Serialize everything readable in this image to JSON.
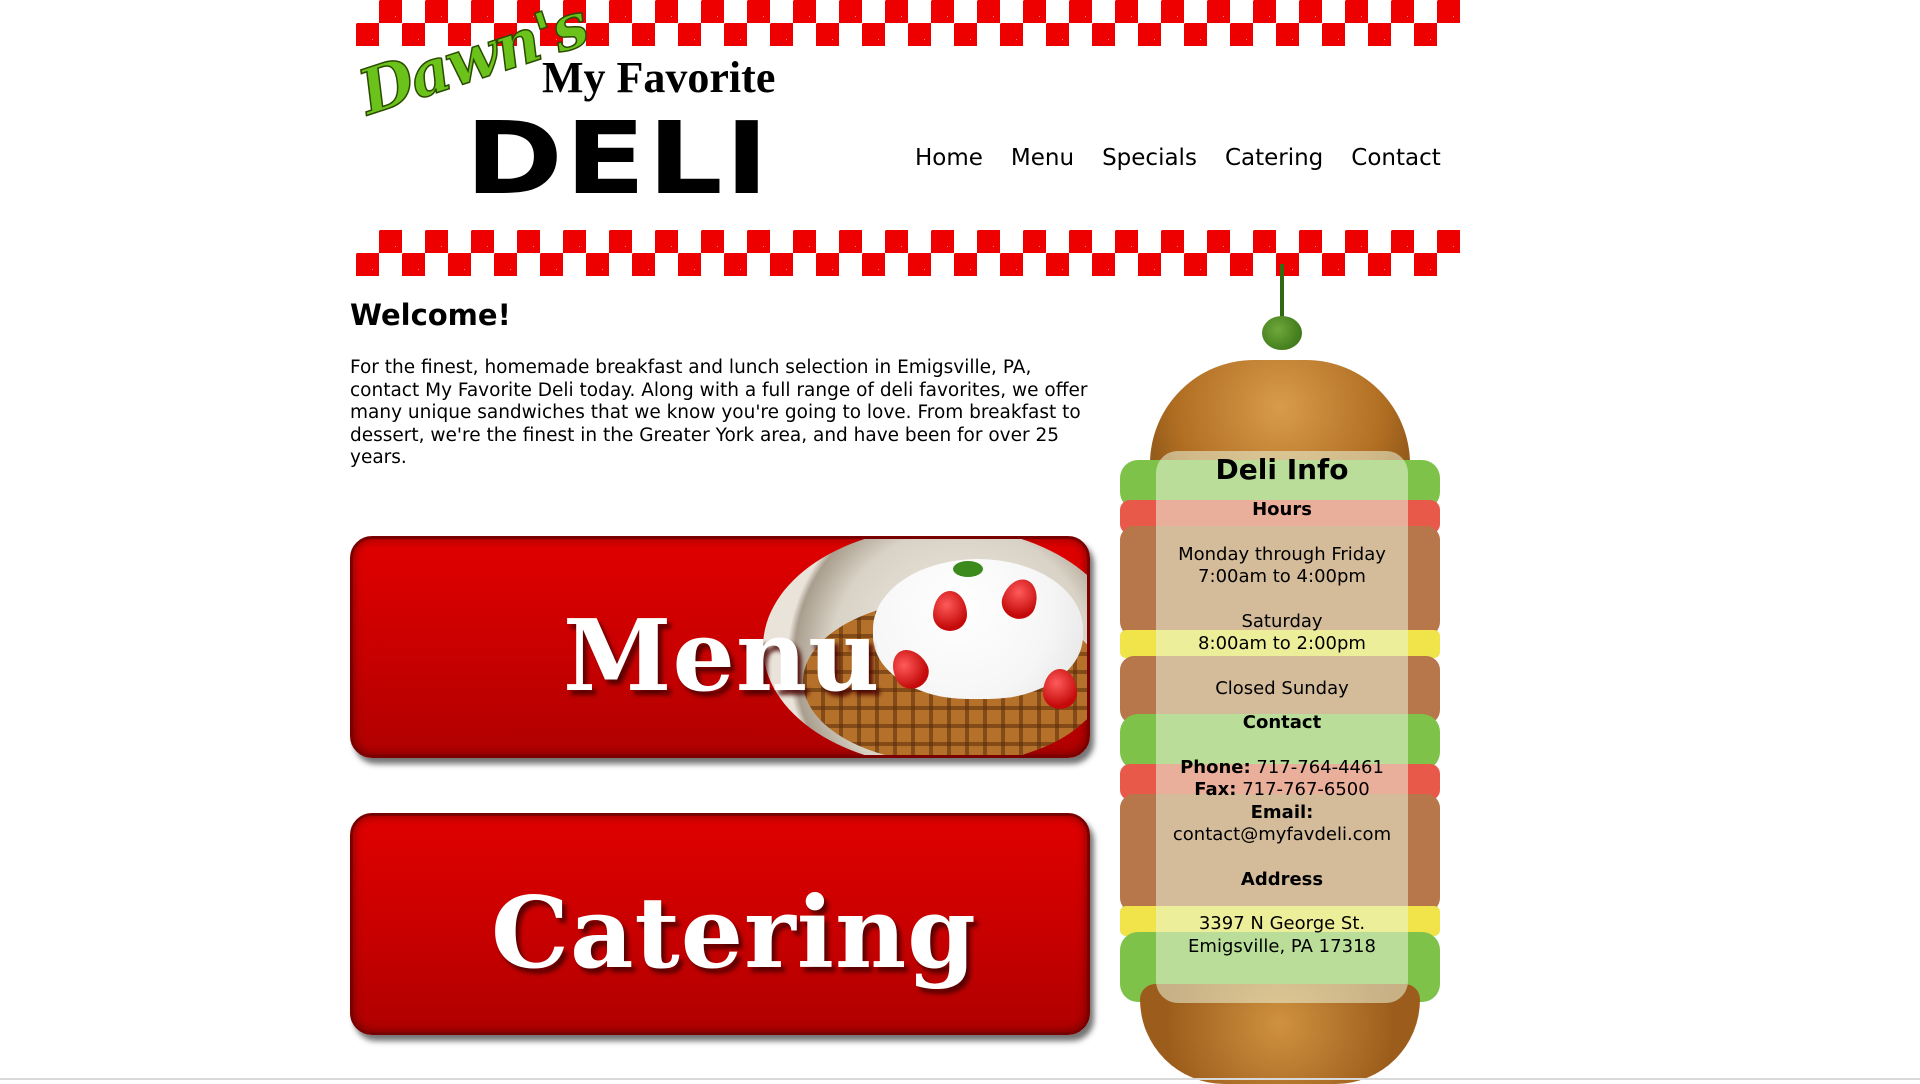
{
  "logo": {
    "script": "Dawn's",
    "line1": "My Favorite",
    "line2": "DELI"
  },
  "nav": {
    "items": [
      "Home",
      "Menu",
      "Specials",
      "Catering",
      "Contact"
    ]
  },
  "welcome": {
    "title": "Welcome!",
    "text": "For the finest, homemade breakfast and lunch selection in Emigsville, PA, contact My Favorite Deli today. Along with a full range of deli favorites, we offer many unique sandwiches that we know you're going to love. From breakfast to dessert, we're the finest in the Greater York area, and have been for over 25 years."
  },
  "promos": {
    "menu_label": "Menu",
    "catering_label": "Catering"
  },
  "info": {
    "title": "Deli Info",
    "hours_heading": "Hours",
    "weekday_days": "Monday through Friday",
    "weekday_time": "7:00am to 4:00pm",
    "saturday_days": "Saturday",
    "saturday_time": "8:00am to 2:00pm",
    "sunday": "Closed Sunday",
    "contact_heading": "Contact",
    "phone_label": "Phone:",
    "phone": "717-764-4461",
    "fax_label": "Fax:",
    "fax": "717-767-6500",
    "email_label": "Email:",
    "email": "contact@myfavdeli.com",
    "address_heading": "Address",
    "address_line1": "3397 N George St.",
    "address_line2": "Emigsville, PA 17318"
  },
  "colors": {
    "accent_red": "#ef0000",
    "button_red": "#c50000",
    "logo_green": "#6bc21a"
  }
}
